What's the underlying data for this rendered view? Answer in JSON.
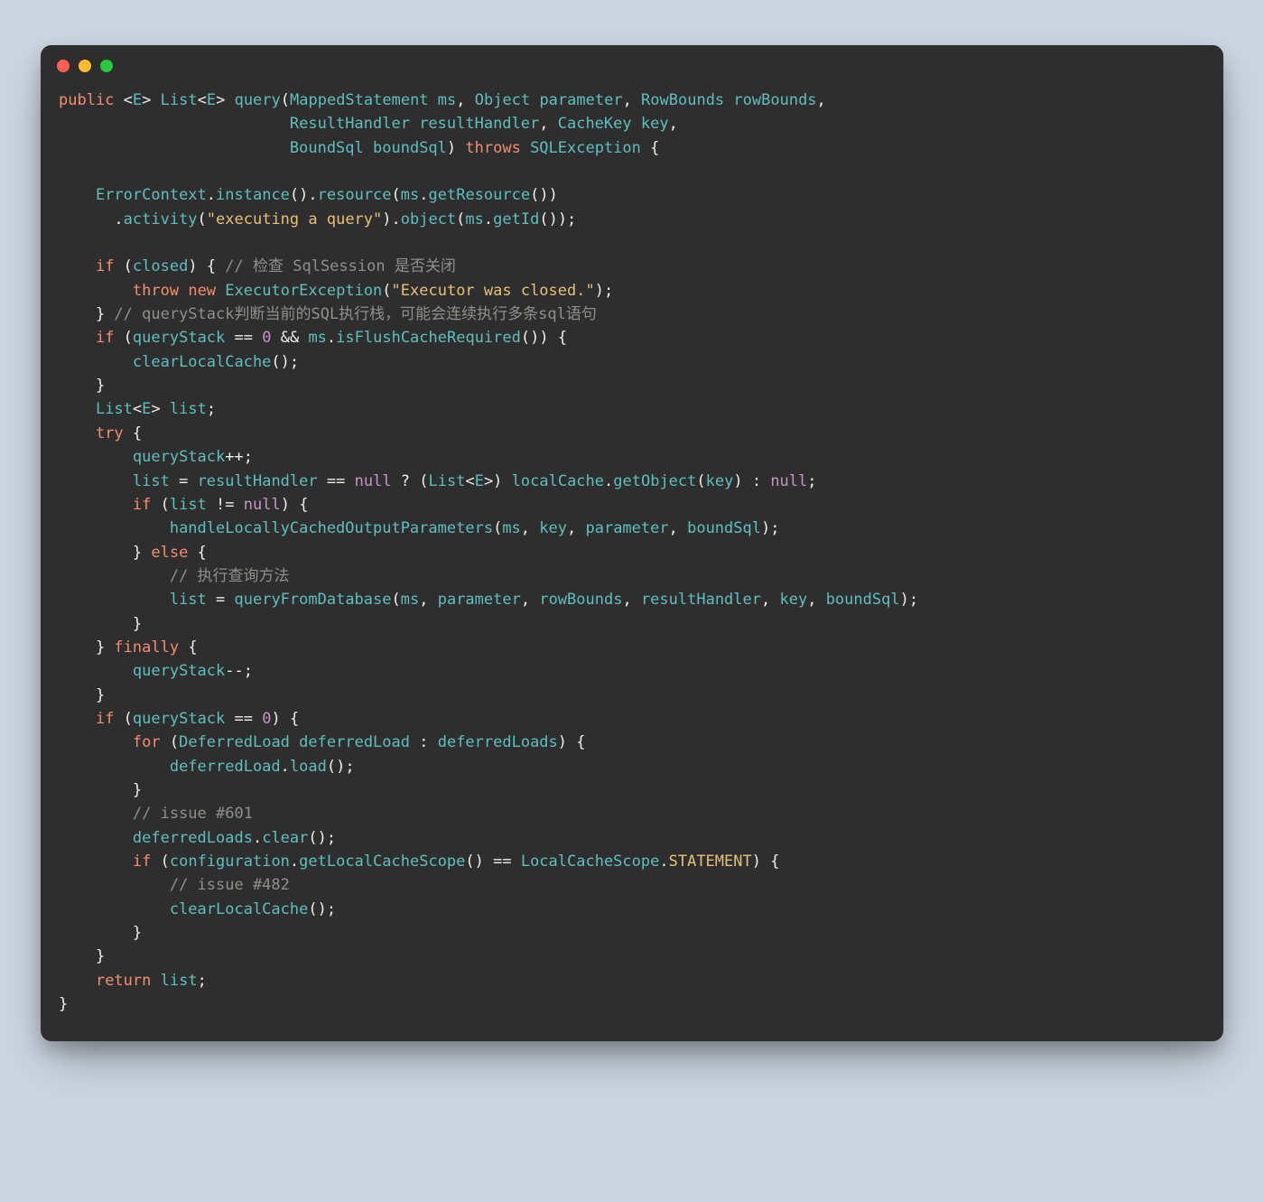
{
  "language": "java",
  "theme": {
    "bg_page": "#cbd5e1",
    "bg_window": "#2e2e2e",
    "titlebar_dots": [
      "#ff5f57",
      "#febc2e",
      "#28c840"
    ],
    "text_default": "#d7d8d2",
    "keyword": "#f38d70",
    "type": "#5fbfbf",
    "string": "#e6c07b",
    "number": "#c695c6",
    "comment": "#8f908a"
  },
  "code_lines": [
    [
      [
        "kw",
        "public"
      ],
      [
        "white",
        " <"
      ],
      [
        "type",
        "E"
      ],
      [
        "white",
        "> "
      ],
      [
        "type",
        "List"
      ],
      [
        "white",
        "<"
      ],
      [
        "type",
        "E"
      ],
      [
        "white",
        "> "
      ],
      [
        "fn",
        "query"
      ],
      [
        "white",
        "("
      ],
      [
        "type",
        "MappedStatement"
      ],
      [
        "white",
        " "
      ],
      [
        "var",
        "ms"
      ],
      [
        "white",
        ", "
      ],
      [
        "type",
        "Object"
      ],
      [
        "white",
        " "
      ],
      [
        "var",
        "parameter"
      ],
      [
        "white",
        ", "
      ],
      [
        "type",
        "RowBounds"
      ],
      [
        "white",
        " "
      ],
      [
        "var",
        "rowBounds"
      ],
      [
        "white",
        ","
      ]
    ],
    [
      [
        "white",
        "                         "
      ],
      [
        "type",
        "ResultHandler"
      ],
      [
        "white",
        " "
      ],
      [
        "var",
        "resultHandler"
      ],
      [
        "white",
        ", "
      ],
      [
        "type",
        "CacheKey"
      ],
      [
        "white",
        " "
      ],
      [
        "var",
        "key"
      ],
      [
        "white",
        ","
      ]
    ],
    [
      [
        "white",
        "                         "
      ],
      [
        "type",
        "BoundSql"
      ],
      [
        "white",
        " "
      ],
      [
        "var",
        "boundSql"
      ],
      [
        "white",
        ") "
      ],
      [
        "kw",
        "throws"
      ],
      [
        "white",
        " "
      ],
      [
        "type",
        "SQLException"
      ],
      [
        "white",
        " {"
      ]
    ],
    [
      [
        "white",
        ""
      ]
    ],
    [
      [
        "white",
        "    "
      ],
      [
        "type",
        "ErrorContext"
      ],
      [
        "white",
        "."
      ],
      [
        "fn",
        "instance"
      ],
      [
        "white",
        "()."
      ],
      [
        "fn",
        "resource"
      ],
      [
        "white",
        "("
      ],
      [
        "var",
        "ms"
      ],
      [
        "white",
        "."
      ],
      [
        "fn",
        "getResource"
      ],
      [
        "white",
        "())"
      ]
    ],
    [
      [
        "white",
        "      ."
      ],
      [
        "fn",
        "activity"
      ],
      [
        "white",
        "("
      ],
      [
        "str",
        "\"executing a query\""
      ],
      [
        "white",
        ")."
      ],
      [
        "fn",
        "object"
      ],
      [
        "white",
        "("
      ],
      [
        "var",
        "ms"
      ],
      [
        "white",
        "."
      ],
      [
        "fn",
        "getId"
      ],
      [
        "white",
        "());"
      ]
    ],
    [
      [
        "white",
        ""
      ]
    ],
    [
      [
        "white",
        "    "
      ],
      [
        "kw",
        "if"
      ],
      [
        "white",
        " ("
      ],
      [
        "var",
        "closed"
      ],
      [
        "white",
        ") { "
      ],
      [
        "cmt",
        "// 检查 SqlSession 是否关闭"
      ]
    ],
    [
      [
        "white",
        "        "
      ],
      [
        "kw",
        "throw"
      ],
      [
        "white",
        " "
      ],
      [
        "kw",
        "new"
      ],
      [
        "white",
        " "
      ],
      [
        "type",
        "ExecutorException"
      ],
      [
        "white",
        "("
      ],
      [
        "str",
        "\"Executor was closed.\""
      ],
      [
        "white",
        ");"
      ]
    ],
    [
      [
        "white",
        "    } "
      ],
      [
        "cmt",
        "// queryStack判断当前的SQL执行栈，可能会连续执行多条sql语句"
      ]
    ],
    [
      [
        "white",
        "    "
      ],
      [
        "kw",
        "if"
      ],
      [
        "white",
        " ("
      ],
      [
        "var",
        "queryStack"
      ],
      [
        "white",
        " == "
      ],
      [
        "num",
        "0"
      ],
      [
        "white",
        " && "
      ],
      [
        "var",
        "ms"
      ],
      [
        "white",
        "."
      ],
      [
        "fn",
        "isFlushCacheRequired"
      ],
      [
        "white",
        "()) {"
      ]
    ],
    [
      [
        "white",
        "        "
      ],
      [
        "fn",
        "clearLocalCache"
      ],
      [
        "white",
        "();"
      ]
    ],
    [
      [
        "white",
        "    }"
      ]
    ],
    [
      [
        "white",
        "    "
      ],
      [
        "type",
        "List"
      ],
      [
        "white",
        "<"
      ],
      [
        "type",
        "E"
      ],
      [
        "white",
        "> "
      ],
      [
        "var",
        "list"
      ],
      [
        "white",
        ";"
      ]
    ],
    [
      [
        "white",
        "    "
      ],
      [
        "kw",
        "try"
      ],
      [
        "white",
        " {"
      ]
    ],
    [
      [
        "white",
        "        "
      ],
      [
        "var",
        "queryStack"
      ],
      [
        "white",
        "++;"
      ]
    ],
    [
      [
        "white",
        "        "
      ],
      [
        "var",
        "list"
      ],
      [
        "white",
        " = "
      ],
      [
        "var",
        "resultHandler"
      ],
      [
        "white",
        " == "
      ],
      [
        "null",
        "null"
      ],
      [
        "white",
        " ? ("
      ],
      [
        "type",
        "List"
      ],
      [
        "white",
        "<"
      ],
      [
        "type",
        "E"
      ],
      [
        "white",
        ">) "
      ],
      [
        "var",
        "localCache"
      ],
      [
        "white",
        "."
      ],
      [
        "fn",
        "getObject"
      ],
      [
        "white",
        "("
      ],
      [
        "var",
        "key"
      ],
      [
        "white",
        ") : "
      ],
      [
        "null",
        "null"
      ],
      [
        "white",
        ";"
      ]
    ],
    [
      [
        "white",
        "        "
      ],
      [
        "kw",
        "if"
      ],
      [
        "white",
        " ("
      ],
      [
        "var",
        "list"
      ],
      [
        "white",
        " != "
      ],
      [
        "null",
        "null"
      ],
      [
        "white",
        ") {"
      ]
    ],
    [
      [
        "white",
        "            "
      ],
      [
        "fn",
        "handleLocallyCachedOutputParameters"
      ],
      [
        "white",
        "("
      ],
      [
        "var",
        "ms"
      ],
      [
        "white",
        ", "
      ],
      [
        "var",
        "key"
      ],
      [
        "white",
        ", "
      ],
      [
        "var",
        "parameter"
      ],
      [
        "white",
        ", "
      ],
      [
        "var",
        "boundSql"
      ],
      [
        "white",
        ");"
      ]
    ],
    [
      [
        "white",
        "        } "
      ],
      [
        "kw",
        "else"
      ],
      [
        "white",
        " {"
      ]
    ],
    [
      [
        "white",
        "            "
      ],
      [
        "cmt",
        "// 执行查询方法"
      ]
    ],
    [
      [
        "white",
        "            "
      ],
      [
        "var",
        "list"
      ],
      [
        "white",
        " = "
      ],
      [
        "fn",
        "queryFromDatabase"
      ],
      [
        "white",
        "("
      ],
      [
        "var",
        "ms"
      ],
      [
        "white",
        ", "
      ],
      [
        "var",
        "parameter"
      ],
      [
        "white",
        ", "
      ],
      [
        "var",
        "rowBounds"
      ],
      [
        "white",
        ", "
      ],
      [
        "var",
        "resultHandler"
      ],
      [
        "white",
        ", "
      ],
      [
        "var",
        "key"
      ],
      [
        "white",
        ", "
      ],
      [
        "var",
        "boundSql"
      ],
      [
        "white",
        ");"
      ]
    ],
    [
      [
        "white",
        "        }"
      ]
    ],
    [
      [
        "white",
        "    } "
      ],
      [
        "kw",
        "finally"
      ],
      [
        "white",
        " {"
      ]
    ],
    [
      [
        "white",
        "        "
      ],
      [
        "var",
        "queryStack"
      ],
      [
        "white",
        "--;"
      ]
    ],
    [
      [
        "white",
        "    }"
      ]
    ],
    [
      [
        "white",
        "    "
      ],
      [
        "kw",
        "if"
      ],
      [
        "white",
        " ("
      ],
      [
        "var",
        "queryStack"
      ],
      [
        "white",
        " == "
      ],
      [
        "num",
        "0"
      ],
      [
        "white",
        ") {"
      ]
    ],
    [
      [
        "white",
        "        "
      ],
      [
        "kw",
        "for"
      ],
      [
        "white",
        " ("
      ],
      [
        "type",
        "DeferredLoad"
      ],
      [
        "white",
        " "
      ],
      [
        "var",
        "deferredLoad"
      ],
      [
        "white",
        " : "
      ],
      [
        "var",
        "deferredLoads"
      ],
      [
        "white",
        ") {"
      ]
    ],
    [
      [
        "white",
        "            "
      ],
      [
        "var",
        "deferredLoad"
      ],
      [
        "white",
        "."
      ],
      [
        "fn",
        "load"
      ],
      [
        "white",
        "();"
      ]
    ],
    [
      [
        "white",
        "        }"
      ]
    ],
    [
      [
        "white",
        "        "
      ],
      [
        "cmt",
        "// issue #601"
      ]
    ],
    [
      [
        "white",
        "        "
      ],
      [
        "var",
        "deferredLoads"
      ],
      [
        "white",
        "."
      ],
      [
        "fn",
        "clear"
      ],
      [
        "white",
        "();"
      ]
    ],
    [
      [
        "white",
        "        "
      ],
      [
        "kw",
        "if"
      ],
      [
        "white",
        " ("
      ],
      [
        "var",
        "configuration"
      ],
      [
        "white",
        "."
      ],
      [
        "fn",
        "getLocalCacheScope"
      ],
      [
        "white",
        "() == "
      ],
      [
        "type",
        "LocalCacheScope"
      ],
      [
        "white",
        "."
      ],
      [
        "lc",
        "STATEMENT"
      ],
      [
        "white",
        ") {"
      ]
    ],
    [
      [
        "white",
        "            "
      ],
      [
        "cmt",
        "// issue #482"
      ]
    ],
    [
      [
        "white",
        "            "
      ],
      [
        "fn",
        "clearLocalCache"
      ],
      [
        "white",
        "();"
      ]
    ],
    [
      [
        "white",
        "        }"
      ]
    ],
    [
      [
        "white",
        "    }"
      ]
    ],
    [
      [
        "white",
        "    "
      ],
      [
        "kw",
        "return"
      ],
      [
        "white",
        " "
      ],
      [
        "var",
        "list"
      ],
      [
        "white",
        ";"
      ]
    ],
    [
      [
        "white",
        "}"
      ]
    ]
  ]
}
